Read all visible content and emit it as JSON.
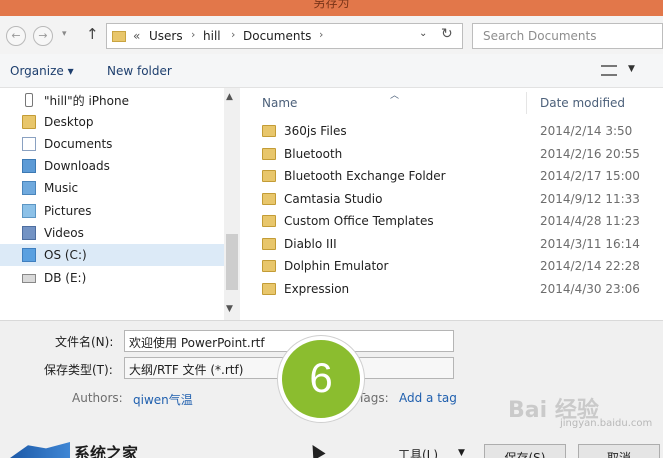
{
  "window": {
    "title": "另存为"
  },
  "nav": {
    "back_icon": "back-arrow-icon",
    "forward_icon": "forward-arrow-icon",
    "up_icon": "up-arrow-icon",
    "breadcrumb": [
      "«",
      "Users",
      "hill",
      "Documents"
    ],
    "refresh_icon": "refresh-icon",
    "search_placeholder": "Search Documents"
  },
  "toolbar": {
    "organize": "Organize ▾",
    "new_folder": "New folder"
  },
  "sidebar": {
    "items": [
      {
        "label": "\"hill\"的 iPhone",
        "icon": "phone-icon"
      },
      {
        "label": "Desktop",
        "icon": "folder-icon"
      },
      {
        "label": "Documents",
        "icon": "documents-icon"
      },
      {
        "label": "Downloads",
        "icon": "downloads-icon"
      },
      {
        "label": "Music",
        "icon": "music-icon"
      },
      {
        "label": "Pictures",
        "icon": "pictures-icon"
      },
      {
        "label": "Videos",
        "icon": "videos-icon"
      },
      {
        "label": "OS (C:)",
        "icon": "drive-icon",
        "selected": true
      },
      {
        "label": "DB (E:)",
        "icon": "drive-icon"
      }
    ]
  },
  "files": {
    "columns": {
      "name": "Name",
      "date": "Date modified"
    },
    "rows": [
      {
        "name": "360js Files",
        "date": "2014/2/14 3:50"
      },
      {
        "name": "Bluetooth",
        "date": "2014/2/16 20:55"
      },
      {
        "name": "Bluetooth Exchange Folder",
        "date": "2014/2/17 15:00"
      },
      {
        "name": "Camtasia Studio",
        "date": "2014/9/12 11:33"
      },
      {
        "name": "Custom Office Templates",
        "date": "2014/4/28 11:23"
      },
      {
        "name": "Diablo III",
        "date": "2014/3/11 16:14"
      },
      {
        "name": "Dolphin Emulator",
        "date": "2014/2/14 22:28"
      },
      {
        "name": "Expression",
        "date": "2014/4/30 23:06"
      }
    ]
  },
  "form": {
    "filename_label": "文件名(N):",
    "filename_value": "欢迎使用 PowerPoint.rtf",
    "type_label": "保存类型(T):",
    "type_value": "大纲/RTF 文件 (*.rtf)",
    "authors_label": "Authors:",
    "authors_value": "qiwen气温",
    "tags_label": "Tags:",
    "tags_value": "Add a tag"
  },
  "buttons": {
    "tools": "工具(L)",
    "save": "保存(S)",
    "cancel": "取消"
  },
  "overlay": {
    "step_number": "6",
    "logo_text": "系统之家",
    "watermark": "Bai 经验",
    "watermark_sub": "jingyan.baidu.com"
  },
  "colors": {
    "accent": "#e2774a",
    "step_badge": "#8bbd2f",
    "link": "#1f5fae"
  }
}
